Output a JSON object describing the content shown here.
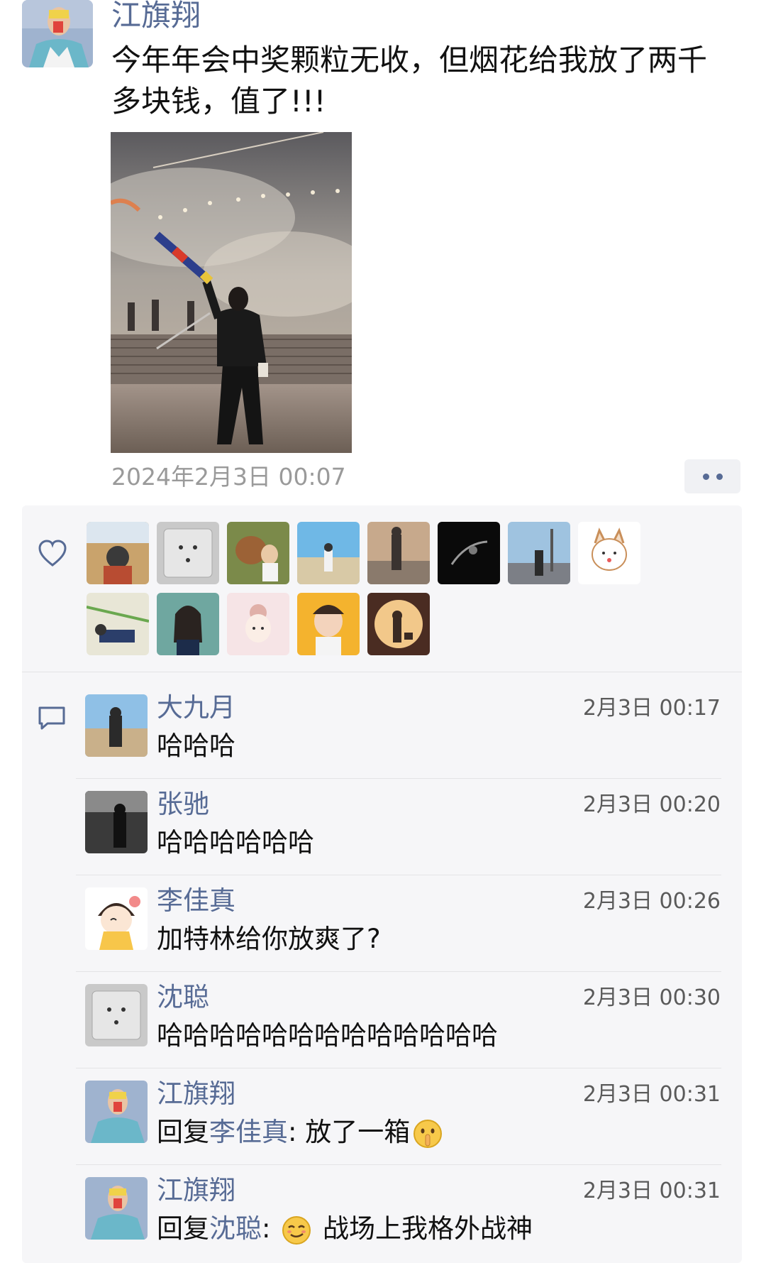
{
  "post": {
    "author": "江旗翔",
    "text": "今年年会中奖颗粒无收，但烟花给我放了两千多块钱，值了!!!",
    "timestamp": "2024年2月3日 00:07"
  },
  "likes": {
    "icon": "heart-icon",
    "count_avatars": 13
  },
  "comments": [
    {
      "name": "大九月",
      "time": "2月3日 00:17",
      "text": "哈哈哈"
    },
    {
      "name": "张驰",
      "time": "2月3日 00:20",
      "text": "哈哈哈哈哈哈"
    },
    {
      "name": "李佳真",
      "time": "2月3日 00:26",
      "text": "加特林给你放爽了?"
    },
    {
      "name": "沈聪",
      "time": "2月3日 00:30",
      "text": "哈哈哈哈哈哈哈哈哈哈哈哈哈"
    },
    {
      "name": "江旗翔",
      "time": "2月3日 00:31",
      "reply_prefix": "回复",
      "reply_to": "李佳真",
      "colon": ": ",
      "text": "放了一箱",
      "emoji": "shush-emoji"
    },
    {
      "name": "江旗翔",
      "time": "2月3日 00:31",
      "reply_prefix": "回复",
      "reply_to": "沈聪",
      "colon": ": ",
      "text": "战场上我格外战神",
      "emoji": "smirk-emoji"
    }
  ],
  "colors": {
    "link_blue": "#576b95",
    "panel_bg": "#f6f6f8",
    "time_gray": "#9a9a9a"
  }
}
